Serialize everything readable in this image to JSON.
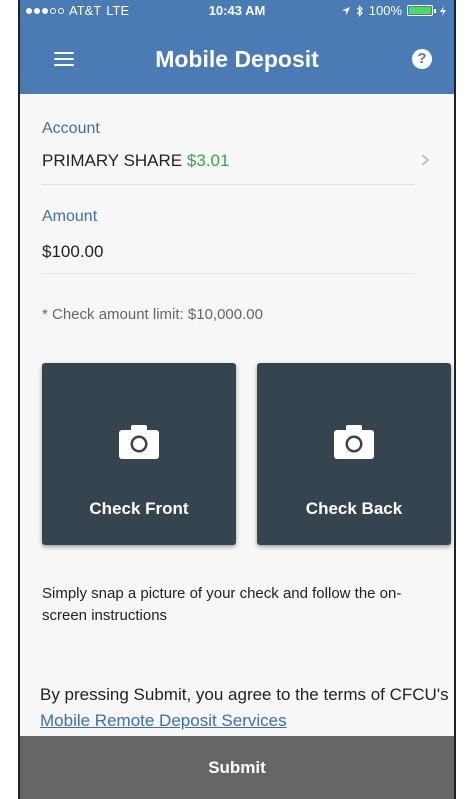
{
  "status_bar": {
    "carrier": "AT&T",
    "network": "LTE",
    "time": "10:43 AM",
    "battery": "100%",
    "battery_level": 1.0,
    "icons": [
      "location-arrow-icon",
      "bluetooth-icon",
      "battery-icon",
      "charging-icon"
    ]
  },
  "header": {
    "title": "Mobile Deposit",
    "menu_icon": "hamburger-menu-icon",
    "help_icon": "help-icon",
    "help_glyph": "?"
  },
  "account": {
    "label": "Account",
    "name": "PRIMARY SHARE",
    "balance": "$3.01",
    "balance_color": "#3aa347"
  },
  "amount": {
    "label": "Amount",
    "value": "$100.00"
  },
  "limit_note": "* Check amount limit: $10,000.00",
  "tiles": {
    "front_label": "Check Front",
    "back_label": "Check Back",
    "icon": "camera-icon"
  },
  "instructions": "Simply snap a picture of your check and follow the on-screen instructions",
  "terms": {
    "text": "By pressing Submit, you agree to the terms of CFCU's ",
    "link": "Mobile Remote Deposit Services"
  },
  "submit_label": "Submit",
  "colors": {
    "header": "#4a7bb5",
    "label": "#3d6fa8",
    "tile": "#36444f",
    "submit_bar": "#606060"
  }
}
